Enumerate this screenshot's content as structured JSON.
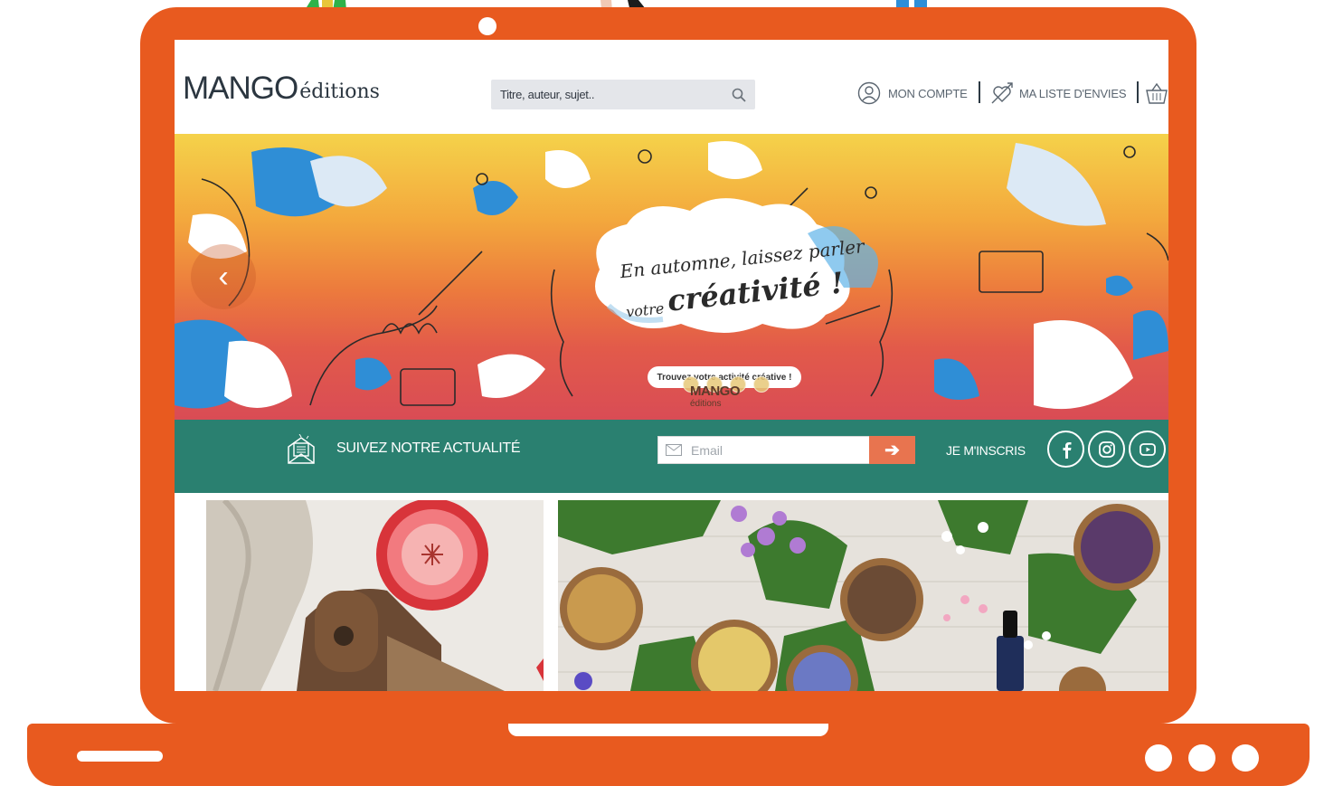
{
  "header": {
    "logo_main": "MANGO",
    "logo_sub": "éditions",
    "search_placeholder": "Titre, auteur, sujet..",
    "account_label": "MON COMPTE",
    "wishlist_label": "MA LISTE D'ENVIES"
  },
  "banner": {
    "headline_line1": "En automne, laissez parler",
    "headline_line2a": "votre",
    "headline_line2b": "créativité !",
    "cta_label": "Trouvez votre activité créative !",
    "mini_logo": "MANGO",
    "mini_logo_sub": "éditions"
  },
  "newsletter": {
    "title": "SUIVEZ NOTRE ACTUALITÉ",
    "email_placeholder": "Email",
    "subscribe_label": "JE M'INSCRIS"
  },
  "icons": {
    "account": "user-circle-icon",
    "wishlist": "heart-arrow-icon",
    "basket": "basket-icon",
    "search": "search-icon",
    "newsletter": "newspaper-icon",
    "social": [
      "facebook-icon",
      "instagram-icon",
      "youtube-icon"
    ]
  },
  "colors": {
    "frame": "#e85a1f",
    "newsletter_band": "#2a8070",
    "submit_button": "#e8744f"
  }
}
